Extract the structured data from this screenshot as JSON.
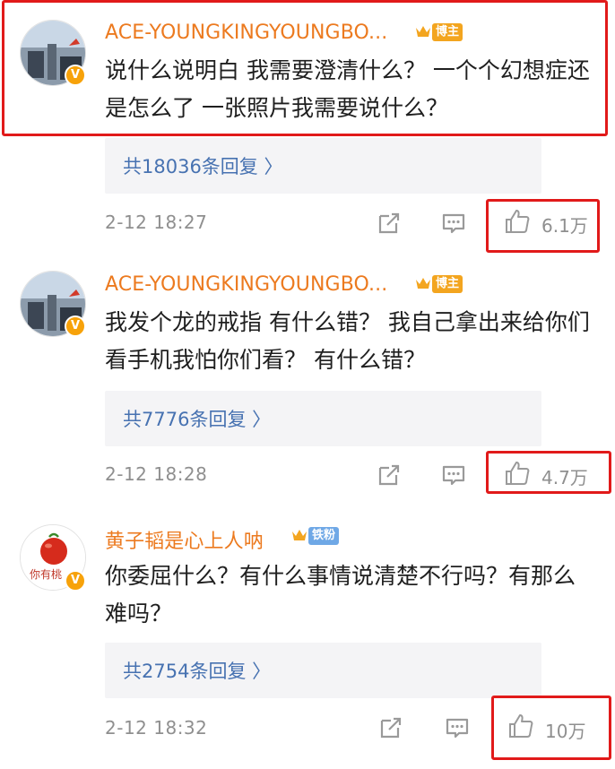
{
  "comments": [
    {
      "username": "ACE-YOUNGKINGYOUNGBO...",
      "badge": "博主",
      "text": "说什么说明白 我需要澄清什么？ 一个个幻想症还是怎么了 一张照片我需要说什么？",
      "replies": "共18036条回复 〉",
      "time": "2-12 18:27",
      "likes": "6.1万"
    },
    {
      "username": "ACE-YOUNGKINGYOUNGBO...",
      "badge": "博主",
      "text": "我发个龙的戒指 有什么错？ 我自己拿出来给你们看手机我怕你们看？ 有什么错？",
      "replies": "共7776条回复 〉",
      "time": "2-12 18:28",
      "likes": "4.7万"
    },
    {
      "username": "黄子韬是心上人呐",
      "badge": "铁粉",
      "avatar_text": "你有桃",
      "text": "你委屈什么？有什么事情说清楚不行吗？有那么难吗？",
      "replies": "共2754条回复 〉",
      "time": "2-12 18:32",
      "likes": "10万"
    }
  ],
  "icons": {
    "share": "share-icon",
    "comment": "comment-icon",
    "like": "thumbs-up-icon",
    "verified": "verified-v-icon",
    "crown": "crown-icon"
  },
  "colors": {
    "username": "#ec7a1f",
    "reply_link": "#4772b1",
    "highlight": "#e11a1a",
    "badge_gold": "#f3a51f",
    "badge_blue": "#6fa8e6"
  }
}
